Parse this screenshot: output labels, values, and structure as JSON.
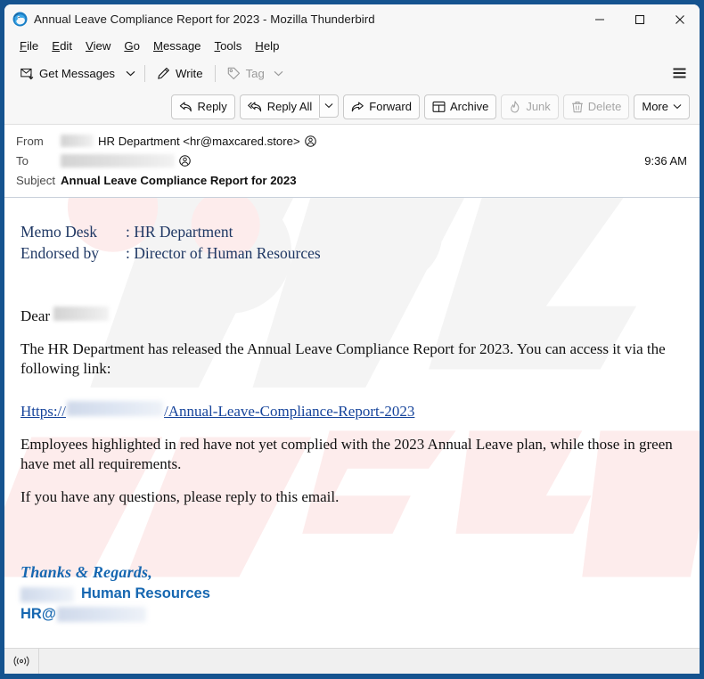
{
  "window": {
    "title": "Annual Leave Compliance Report for 2023 - Mozilla Thunderbird",
    "app_icon": "thunderbird-logo-icon",
    "minimize_label": "—",
    "maximize_label": "☐",
    "close_label": "✕"
  },
  "menu_bar": {
    "items": [
      {
        "label": "File",
        "accel": "F"
      },
      {
        "label": "Edit",
        "accel": "E"
      },
      {
        "label": "View",
        "accel": "V"
      },
      {
        "label": "Go",
        "accel": "G"
      },
      {
        "label": "Message",
        "accel": "M"
      },
      {
        "label": "Tools",
        "accel": "T"
      },
      {
        "label": "Help",
        "accel": "H"
      }
    ]
  },
  "main_toolbar": {
    "get_messages": "Get Messages",
    "get_messages_icon": "envelope-download-icon",
    "get_messages_chevron": "chevron-down-icon",
    "write": "Write",
    "write_icon": "pencil-icon",
    "tag": "Tag",
    "tag_icon": "tag-icon",
    "tag_chevron": "chevron-down-icon",
    "app_menu_icon": "hamburger-menu-icon"
  },
  "message_toolbar": {
    "reply": "Reply",
    "reply_icon": "reply-arrow-icon",
    "reply_all": "Reply All",
    "reply_all_icon": "reply-all-arrow-icon",
    "reply_all_chevron": "chevron-down-icon",
    "forward": "Forward",
    "forward_icon": "forward-arrow-icon",
    "archive": "Archive",
    "archive_icon": "archive-box-icon",
    "junk": "Junk",
    "junk_icon": "junk-flame-icon",
    "delete": "Delete",
    "delete_icon": "trash-can-icon",
    "more": "More",
    "more_chevron": "chevron-down-icon"
  },
  "headers": {
    "from_label": "From",
    "from_value": "HR Department <hr@maxcared.store>",
    "from_redacted": true,
    "from_contact_icon": "contact-avatar-icon",
    "to_label": "To",
    "to_value": "",
    "to_redacted": true,
    "to_contact_icon": "contact-avatar-icon",
    "subject_label": "Subject",
    "subject_value": "Annual Leave Compliance Report for 2023",
    "time": "9:36 AM"
  },
  "body": {
    "memo": [
      {
        "key": "Memo Desk",
        "value": ": HR Department"
      },
      {
        "key": "Endorsed by",
        "value": ": Director of Human Resources"
      }
    ],
    "greeting": "Dear",
    "greeting_redacted": true,
    "paragraph_1": "The HR Department has released the Annual Leave Compliance Report for 2023. You can access it via the following link:",
    "link_prefix": "Https://",
    "link_redacted": true,
    "link_suffix": "/Annual-Leave-Compliance-Report-2023",
    "paragraph_2": "Employees highlighted in red have not yet complied with the 2023 Annual Leave plan, while those in green have met all requirements.",
    "paragraph_3": "If you have any questions, please reply to this email.",
    "signature_thanks": "Thanks & Regards,",
    "signature_department": "Human Resources",
    "signature_department_redacted": true,
    "signature_email_prefix": "HR@",
    "signature_email_redacted": true
  },
  "status_bar": {
    "icon": "broadcast-signal-icon"
  },
  "colors": {
    "window_border": "#15538f",
    "chrome_background": "#f7f7f7",
    "memo_text": "#1f3864",
    "link": "#16449b",
    "signature": "#1667b1",
    "body_text": "#111111"
  }
}
